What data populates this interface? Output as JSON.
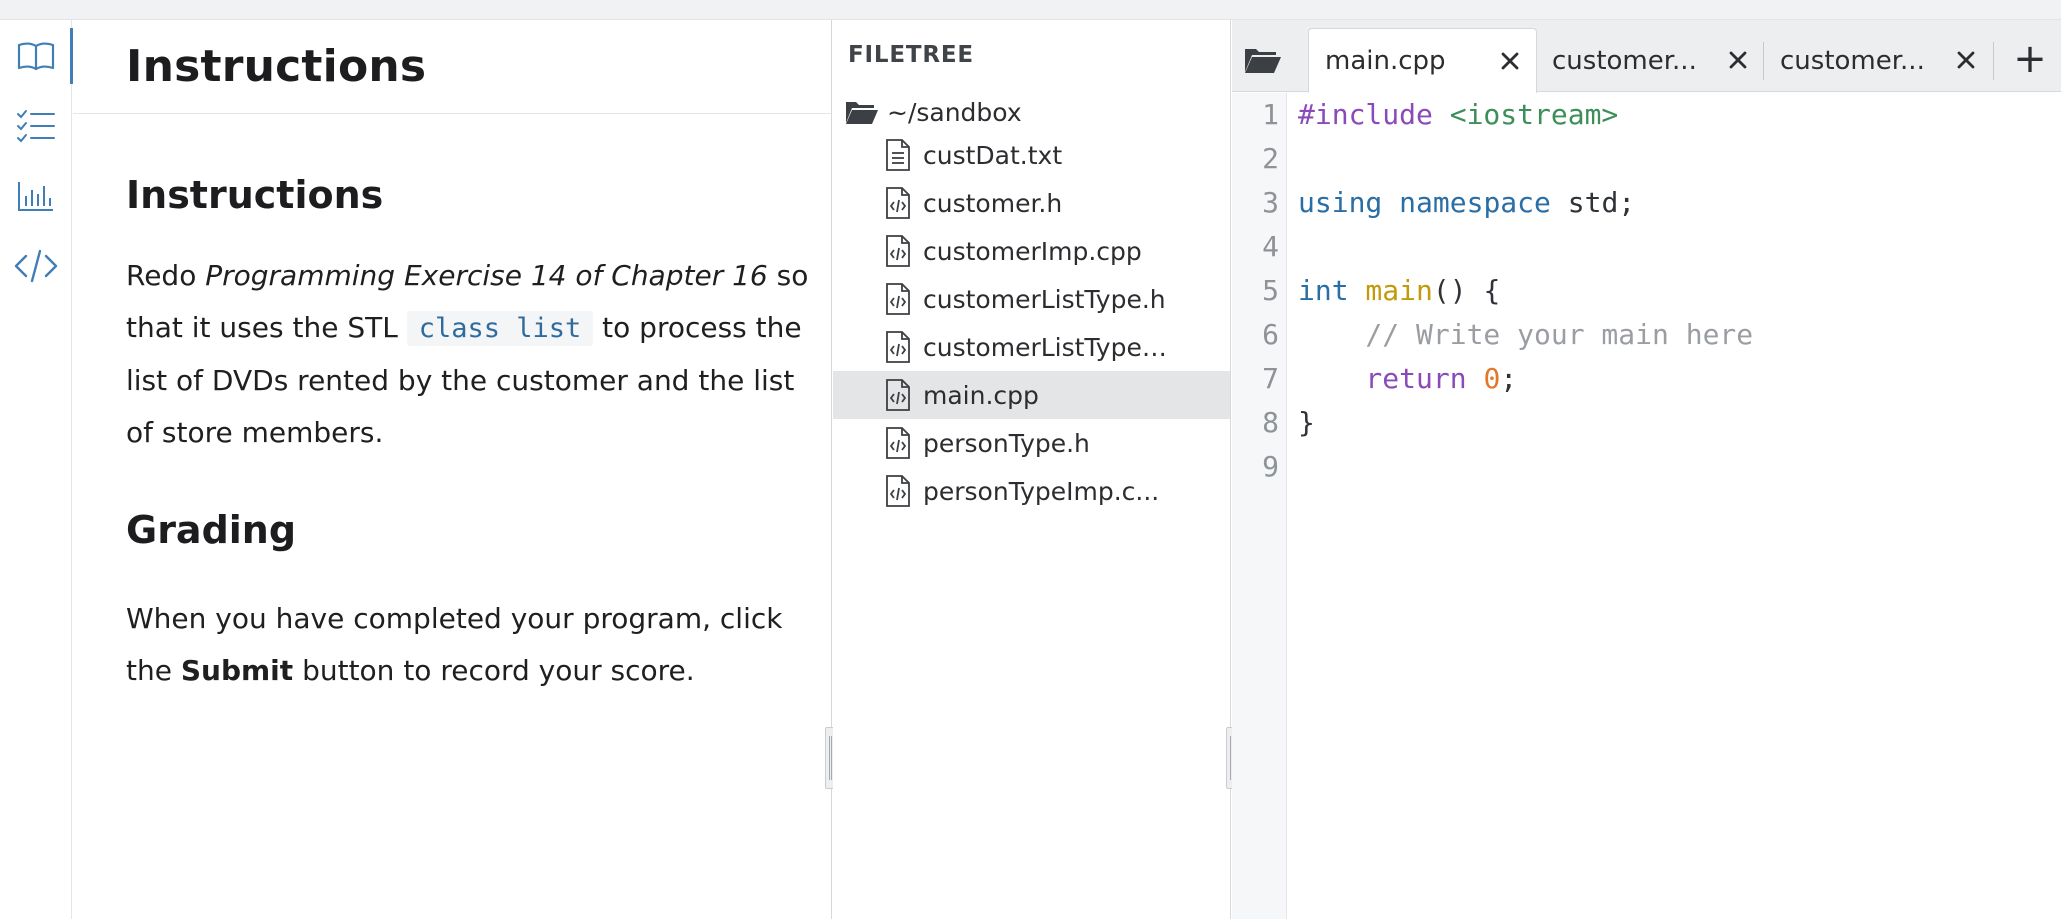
{
  "colors": {
    "accent": "#3f7eb6",
    "keyword": "#8a4bb8",
    "string": "#3e8e5a",
    "type": "#2a6ea6",
    "function": "#c19a0e",
    "comment": "#9a9ea3",
    "number": "#e3772b"
  },
  "rail": {
    "icons": [
      "book-icon",
      "checklist-icon",
      "bar-chart-icon",
      "code-icon"
    ],
    "active_index": 0
  },
  "instructions": {
    "header_title": "Instructions",
    "section1_title": "Instructions",
    "p1_redo": "Redo ",
    "p1_exercise": "Programming Exercise 14 of Chapter 16",
    "p1_so_that": " so that it uses the STL ",
    "p1_code": "class list",
    "p1_rest": " to process the list of DVDs rented by the customer and the list of store members.",
    "section2_title": "Grading",
    "p2_start": "When you have completed your program, click the ",
    "p2_bold": "Submit",
    "p2_end": " button to record your score."
  },
  "filetree": {
    "title": "FILETREE",
    "root": "~/sandbox",
    "files": [
      {
        "label": "custDat.txt",
        "type": "text-file-icon"
      },
      {
        "label": "customer.h",
        "type": "code-file-icon"
      },
      {
        "label": "customerImp.cpp",
        "type": "code-file-icon"
      },
      {
        "label": "customerListType.h",
        "type": "code-file-icon"
      },
      {
        "label": "customerListTypeI...",
        "type": "code-file-icon"
      },
      {
        "label": "main.cpp",
        "type": "code-file-icon",
        "selected": true
      },
      {
        "label": "personType.h",
        "type": "code-file-icon"
      },
      {
        "label": "personTypeImp.c...",
        "type": "code-file-icon"
      }
    ]
  },
  "editor": {
    "tabs": [
      {
        "label": "main.cpp",
        "active": true
      },
      {
        "label": "customer...",
        "active": false
      },
      {
        "label": "customer...",
        "active": false
      }
    ],
    "add_tab": "+",
    "line_numbers": [
      "1",
      "2",
      "3",
      "4",
      "5",
      "6",
      "7",
      "8",
      "9"
    ],
    "code": {
      "l1_directive": "#include",
      "l1_header": " <iostream>",
      "l3_using": "using",
      "l3_namespace": " namespace",
      "l3_rest": " std;",
      "l5_int": "int",
      "l5_main": " main",
      "l5_rest": "() {",
      "l6_comment": "    // Write your main here",
      "l7_return": "    return",
      "l7_space": " ",
      "l7_zero": "0",
      "l7_semi": ";",
      "l8_brace": "}"
    }
  }
}
